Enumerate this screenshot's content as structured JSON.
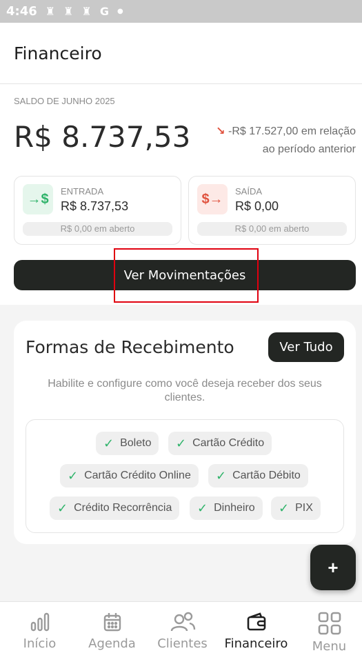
{
  "status_bar": {
    "time": "4:46"
  },
  "header": {
    "title": "Financeiro"
  },
  "balance": {
    "period_label": "SALDO DE JUNHO 2025",
    "amount": "R$ 8.737,53",
    "delta_line1": "-R$ 17.527,00 em relação",
    "delta_line2": "ao período anterior",
    "income": {
      "label": "ENTRADA",
      "value": "R$ 8.737,53",
      "pending": "R$ 0,00 em aberto"
    },
    "expense": {
      "label": "SAÍDA",
      "value": "R$ 0,00",
      "pending": "R$ 0,00 em aberto"
    },
    "view_button": "Ver Movimentações"
  },
  "methods": {
    "title": "Formas de Recebimento",
    "view_all": "Ver Tudo",
    "description": "Habilite e configure como você deseja receber dos seus clientes.",
    "items": [
      "Boleto",
      "Cartão Crédito",
      "Cartão Crédito Online",
      "Cartão Débito",
      "Crédito Recorrência",
      "Dinheiro",
      "PIX"
    ]
  },
  "fab": {
    "label": "+"
  },
  "nav": {
    "items": [
      {
        "label": "Início",
        "icon": "chart-icon"
      },
      {
        "label": "Agenda",
        "icon": "calendar-icon"
      },
      {
        "label": "Clientes",
        "icon": "users-icon"
      },
      {
        "label": "Financeiro",
        "icon": "wallet-icon",
        "active": true
      },
      {
        "label": "Menu",
        "icon": "grid-icon"
      }
    ]
  },
  "colors": {
    "accent_dark": "#232623",
    "positive": "#2fb36a",
    "negative": "#e0533f",
    "highlight": "#e0000f"
  }
}
